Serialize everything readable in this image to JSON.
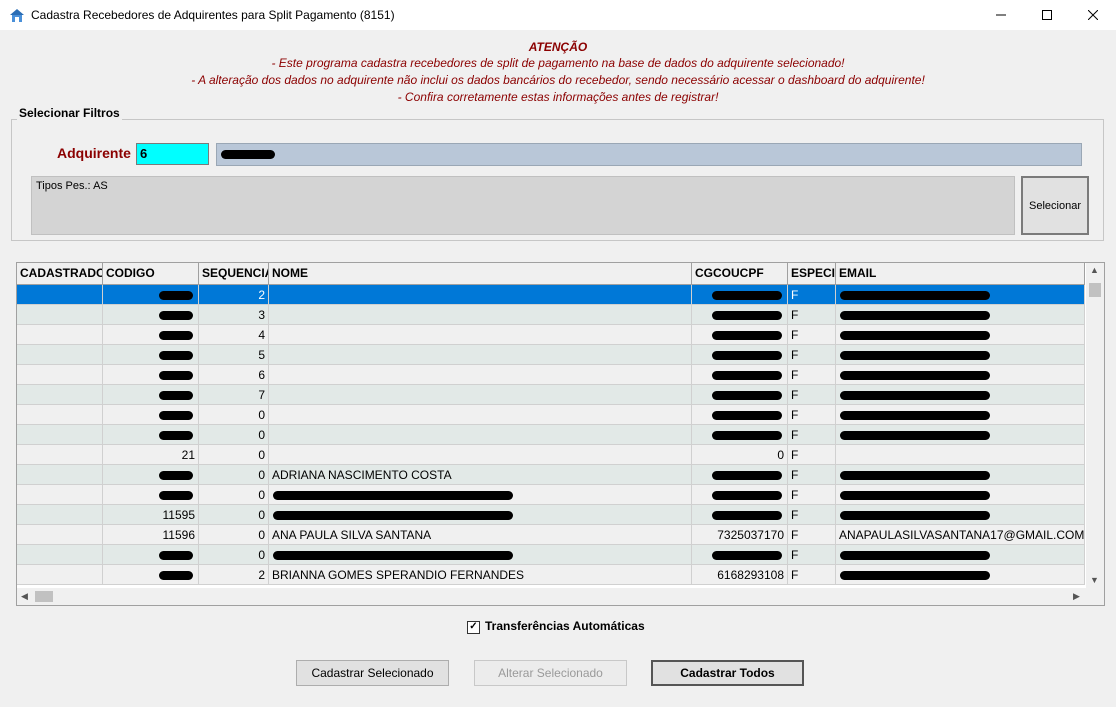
{
  "window": {
    "title": "Cadastra Recebedores de Adquirentes para Split Pagamento (8151)"
  },
  "notice": {
    "title": "ATENÇÃO",
    "lines": [
      "- Este programa cadastra recebedores de split de pagamento na base de dados do adquirente selecionado!",
      "- A alteração dos dados no adquirente não inclui os dados bancários do recebedor, sendo necessário acessar o dashboard do adquirente!",
      "- Confira corretamente estas informações antes de registrar!"
    ]
  },
  "filters": {
    "legend": "Selecionar Filtros",
    "adquirente_label": "Adquirente",
    "adquirente_code": "6",
    "adquirente_name": "Pag...M...",
    "tipos": "Tipos Pes.: AS",
    "select_button": "Selecionar"
  },
  "grid": {
    "columns": [
      "CADASTRADO",
      "CODIGO",
      "SEQUENCIA",
      "NOME",
      "CGCOUCPF",
      "ESPECIE",
      "EMAIL"
    ],
    "rows": [
      [
        "",
        "",
        "2",
        "",
        "",
        "F",
        ""
      ],
      [
        "",
        "",
        "3",
        "",
        "",
        "F",
        ""
      ],
      [
        "",
        "",
        "4",
        "",
        "",
        "F",
        ""
      ],
      [
        "",
        "",
        "5",
        "",
        "",
        "F",
        ""
      ],
      [
        "",
        "",
        "6",
        "",
        "",
        "F",
        ""
      ],
      [
        "",
        "",
        "7",
        "",
        "",
        "F",
        ""
      ],
      [
        "",
        "",
        "0",
        "",
        "",
        "F",
        ""
      ],
      [
        "",
        "",
        "0",
        "",
        "",
        "F",
        ""
      ],
      [
        "",
        "21",
        "0",
        "",
        "0",
        "F",
        ""
      ],
      [
        "",
        "",
        "0",
        "ADRIANA NASCIMENTO COSTA",
        "",
        "F",
        ""
      ],
      [
        "",
        "",
        "0",
        "",
        "",
        "F",
        ""
      ],
      [
        "",
        "11595",
        "0",
        "",
        "",
        "F",
        ""
      ],
      [
        "",
        "11596",
        "0",
        "ANA PAULA SILVA SANTANA",
        "7325037170",
        "F",
        "ANAPAULASILVASANTANA17@GMAIL.COM"
      ],
      [
        "",
        "",
        "0",
        "",
        "",
        "F",
        ""
      ],
      [
        "",
        "",
        "2",
        "BRIANNA GOMES SPERANDIO FERNANDES",
        "6168293108",
        "F",
        ""
      ]
    ]
  },
  "options": {
    "auto_transfer_label": "Transferências Automáticas",
    "auto_transfer_checked": "✓"
  },
  "buttons": {
    "cadastrar_selecionado": "Cadastrar Selecionado",
    "alterar_selecionado": "Alterar Selecionado",
    "cadastrar_todos": "Cadastrar Todos"
  },
  "colors": {
    "selected_row": "#0078d7",
    "attention": "#8b0000",
    "code_field": "#00ffff"
  },
  "icons": {
    "app": "app-icon",
    "minimize": "minimize-icon",
    "maximize": "maximize-icon",
    "close": "close-icon"
  }
}
